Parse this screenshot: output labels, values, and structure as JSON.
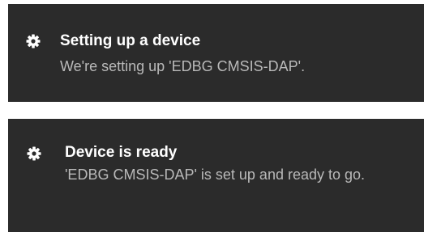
{
  "notifications": [
    {
      "icon": "gear-icon",
      "title": "Setting up a device",
      "body": "We're setting up 'EDBG CMSIS-DAP'."
    },
    {
      "icon": "gear-icon",
      "title": "Device is ready",
      "body": "'EDBG CMSIS-DAP' is set up and ready to go."
    }
  ],
  "colors": {
    "toast_background": "#2b2b2b",
    "title_text": "#ffffff",
    "body_text": "#b9b9b9",
    "page_background": "#ffffff"
  }
}
